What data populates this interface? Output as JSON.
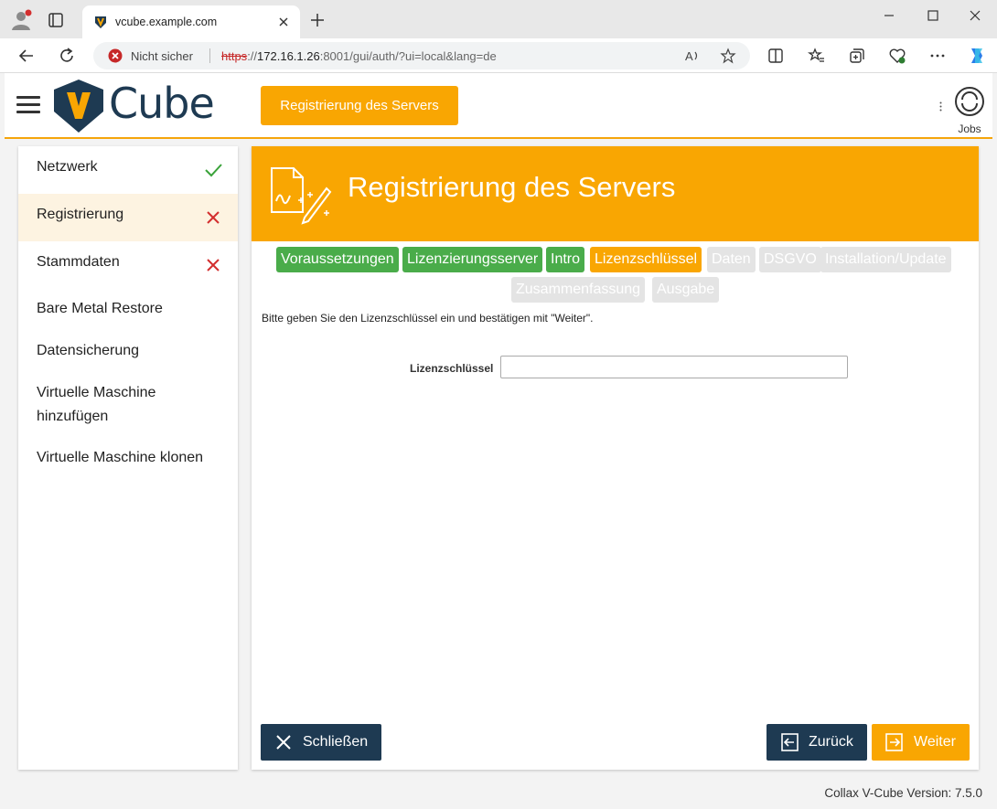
{
  "browser": {
    "tab_title": "vcube.example.com",
    "security_label": "Nicht sicher",
    "url_scheme": "https",
    "url_rest_prefix": "://",
    "url_host": "172.16.1.26",
    "url_path": ":8001/gui/auth/?ui=local&lang=de"
  },
  "header": {
    "brand": "Cube",
    "brand_logo_letter": "V",
    "action_button": "Registrierung des Servers",
    "jobs_label": "Jobs"
  },
  "sidebar": {
    "items": [
      {
        "label": "Netzwerk",
        "status": "ok"
      },
      {
        "label": "Registrierung",
        "status": "error",
        "active": true
      },
      {
        "label": "Stammdaten",
        "status": "error"
      },
      {
        "label": "Bare Metal Restore"
      },
      {
        "label": "Datensicherung"
      },
      {
        "label": "Virtuelle Maschine",
        "label2": "hinzufügen"
      },
      {
        "label": "Virtuelle Maschine klonen"
      }
    ]
  },
  "main": {
    "title": "Registrierung des Servers",
    "steps": [
      {
        "label": "Voraussetzungen",
        "state": "done"
      },
      {
        "label": "Lizenzierungsserver",
        "state": "done"
      },
      {
        "label": "Intro",
        "state": "done"
      },
      {
        "label": "Lizenzschlüssel",
        "state": "current"
      },
      {
        "label": "Daten",
        "state": "todo"
      },
      {
        "label": "DSGVO",
        "state": "todo"
      },
      {
        "label": "Installation/Update",
        "state": "todo"
      },
      {
        "label": "Zusammenfassung",
        "state": "todo"
      },
      {
        "label": "Ausgabe",
        "state": "todo"
      }
    ],
    "instruction": "Bitte geben Sie den Lizenzschlüssel ein und bestätigen mit \"Weiter\".",
    "field_label": "Lizenzschlüssel",
    "field_value": "",
    "buttons": {
      "close": "Schließen",
      "back": "Zurück",
      "next": "Weiter"
    }
  },
  "footer": {
    "version": "Collax V-Cube Version: 7.5.0"
  },
  "colors": {
    "accent": "#f9a602",
    "step_done": "#4aac4a",
    "step_todo": "#e4e4e4",
    "dark_button": "#1e3a52",
    "brand_text": "#1e3a52"
  }
}
